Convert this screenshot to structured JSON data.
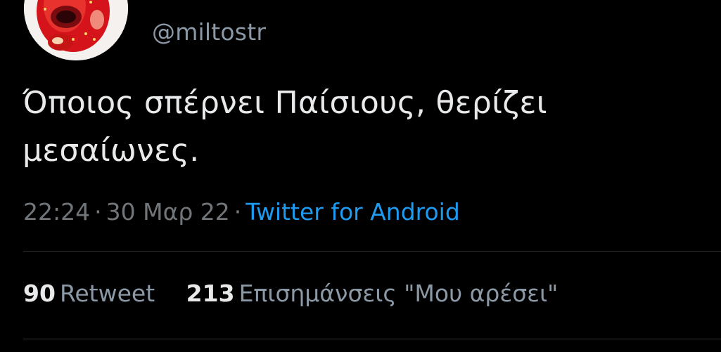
{
  "user": {
    "handle": "@miltostr",
    "avatar_icon": "strawberry-avatar"
  },
  "tweet": {
    "text_line1": "Όποιος σπέρνει Παίσιους, θερίζει",
    "text_line2": "μεσαίωνες.",
    "time": "22:24",
    "date": "30 Μαρ 22",
    "separator": "·",
    "source": "Twitter for Android"
  },
  "stats": {
    "retweets_count": "90",
    "retweets_label": "Retweet",
    "likes_count": "213",
    "likes_label": "Επισημάνσεις \"Μου αρέσει\""
  },
  "colors": {
    "background": "#000000",
    "text": "#e7e9ea",
    "muted": "#71767b",
    "link": "#1d9bf0",
    "divider": "#2f3336"
  }
}
